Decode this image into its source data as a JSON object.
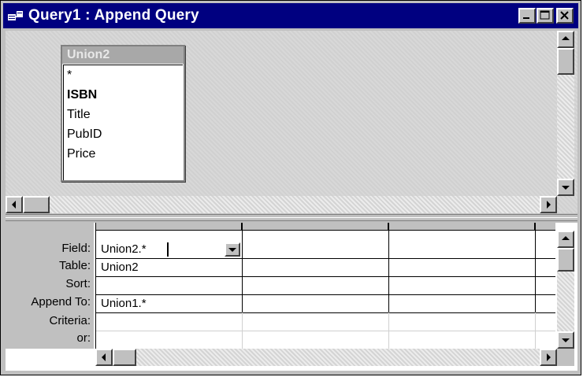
{
  "window": {
    "title": "Query1 : Append Query",
    "icons": {
      "app": "query-window-icon",
      "minimize": "minimize-icon",
      "maximize": "maximize-icon",
      "close": "close-icon"
    }
  },
  "table_box": {
    "title": "Union2",
    "fields": [
      "*",
      "ISBN",
      "Title",
      "PubID",
      "Price"
    ],
    "key_field": "ISBN"
  },
  "design_grid": {
    "row_labels": [
      "Field:",
      "Table:",
      "Sort:",
      "Append To:",
      "Criteria:",
      "or:"
    ],
    "columns": [
      {
        "field": "Union2.*",
        "table": "Union2",
        "sort": "",
        "append_to": "Union1.*",
        "criteria": "",
        "or": ""
      },
      {
        "field": "",
        "table": "",
        "sort": "",
        "append_to": "",
        "criteria": "",
        "or": ""
      },
      {
        "field": "",
        "table": "",
        "sort": "",
        "append_to": "",
        "criteria": "",
        "or": ""
      }
    ]
  }
}
